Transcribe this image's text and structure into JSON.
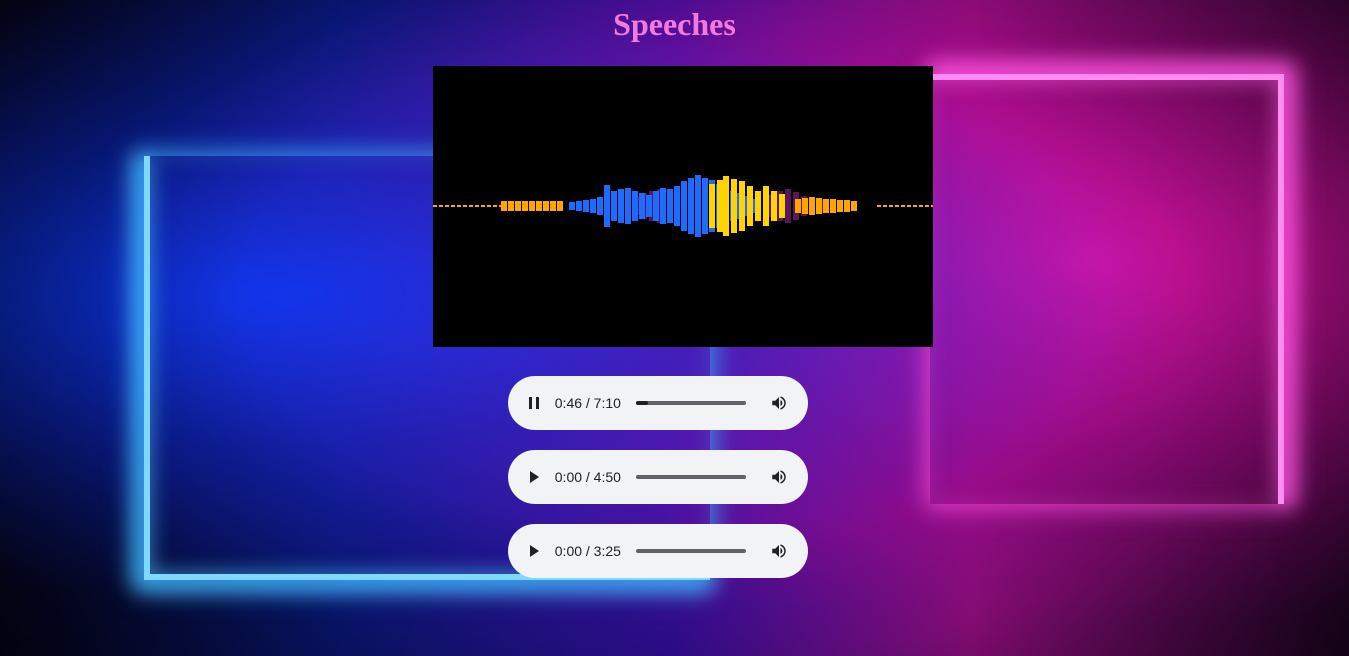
{
  "page": {
    "title": "Speeches",
    "title_color": "#f27adf"
  },
  "visualizer": {
    "colors": {
      "orange": "#ffa500",
      "blue": "#1e6cff",
      "yellow": "#ffd400",
      "purple": "#6a1a6a"
    }
  },
  "players": [
    {
      "state": "playing",
      "icon": "pause-icon",
      "time": "0:46 / 7:10",
      "progress": 0.107
    },
    {
      "state": "paused",
      "icon": "play-icon",
      "time": "0:00 / 4:50",
      "progress": 0.0
    },
    {
      "state": "paused",
      "icon": "play-icon",
      "time": "0:00 / 3:25",
      "progress": 0.0
    }
  ]
}
